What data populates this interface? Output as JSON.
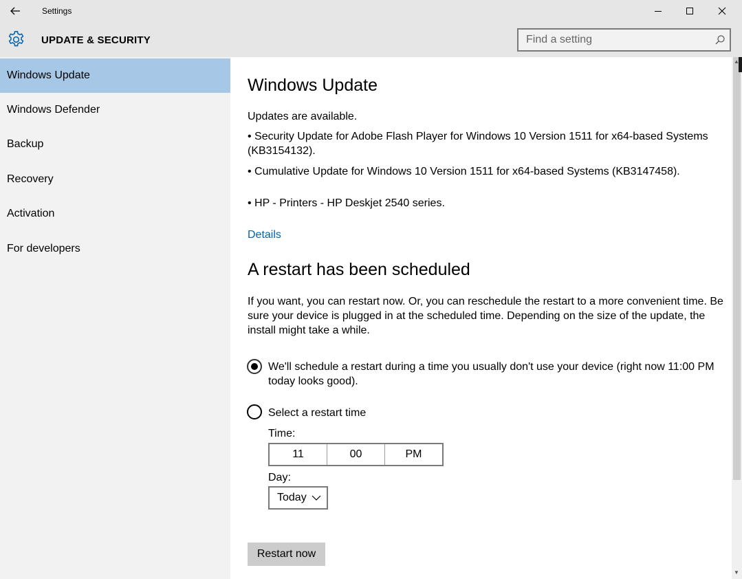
{
  "window": {
    "title": "Settings",
    "back_icon": "back-arrow-icon",
    "minimize_icon": "minimize-icon",
    "maximize_icon": "maximize-icon",
    "close_icon": "close-icon"
  },
  "header": {
    "icon": "gear-icon",
    "title": "UPDATE & SECURITY",
    "accent_color": "#0063b1",
    "search": {
      "placeholder": "Find a setting",
      "value": "",
      "icon": "search-icon"
    }
  },
  "sidebar": {
    "selected_color": "#a6c8e6",
    "items": [
      {
        "label": "Windows Update",
        "selected": true
      },
      {
        "label": "Windows Defender",
        "selected": false
      },
      {
        "label": "Backup",
        "selected": false
      },
      {
        "label": "Recovery",
        "selected": false
      },
      {
        "label": "Activation",
        "selected": false
      },
      {
        "label": "For developers",
        "selected": false
      }
    ]
  },
  "main": {
    "title": "Windows Update",
    "status": "Updates are available.",
    "updates": [
      {
        "line1": "• Security Update for Adobe Flash Player for Windows 10 Version 1511 for x64-based Systems",
        "line2": "(KB3154132)."
      },
      {
        "line1": "• Cumulative Update for Windows 10 Version 1511 for x64-based Systems (KB3147458)."
      },
      {
        "line1": "• HP - Printers - HP Deskjet 2540 series."
      }
    ],
    "details_link": "Details",
    "restart_section": {
      "title": "A restart has been scheduled",
      "description_lines": [
        "If you want, you can restart now. Or, you can reschedule the restart to a more convenient time. Be",
        "sure your device is plugged in at the scheduled time. Depending on the size of the update, the",
        "install might take a while."
      ],
      "option_auto": {
        "line1": "We'll schedule a restart during a time you usually don't use your device (right now 11:00 PM",
        "line2": "today looks good).",
        "checked": true
      },
      "option_manual": {
        "label": "Select a restart time",
        "checked": false
      },
      "time_label": "Time:",
      "time": {
        "hour": "11",
        "minute": "00",
        "period": "PM"
      },
      "day_label": "Day:",
      "day": {
        "value": "Today",
        "icon": "chevron-down-icon"
      },
      "restart_button": "Restart now"
    }
  }
}
